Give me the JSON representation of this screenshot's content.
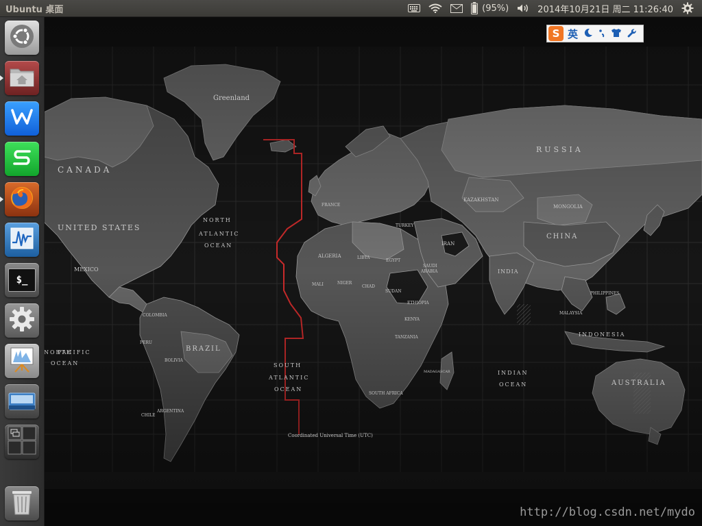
{
  "top_panel": {
    "app_title": "Ubuntu 桌面",
    "battery_percent": "(95%)",
    "datetime": "2014年10月21日 周二 11:26:40",
    "icons": [
      "keyboard-icon",
      "wifi-icon",
      "mail-icon",
      "battery-icon",
      "volume-icon",
      "gear-icon"
    ]
  },
  "launcher": {
    "items": [
      {
        "name": "dash-home",
        "icon": "ubuntu-logo-icon",
        "running": false
      },
      {
        "name": "files",
        "icon": "home-folder-icon",
        "running": true
      },
      {
        "name": "wps-writer",
        "icon": "wps-writer-icon",
        "label": "W",
        "running": false
      },
      {
        "name": "wps-spreadsheets",
        "icon": "wps-spreadsheets-icon",
        "label": "S",
        "running": false
      },
      {
        "name": "firefox",
        "icon": "firefox-icon",
        "running": true
      },
      {
        "name": "system-monitor",
        "icon": "system-monitor-icon",
        "running": false
      },
      {
        "name": "terminal",
        "icon": "terminal-icon",
        "label": "$_",
        "running": false
      },
      {
        "name": "system-settings",
        "icon": "settings-gear-icon",
        "running": false
      },
      {
        "name": "presentation",
        "icon": "presentation-icon",
        "running": false
      },
      {
        "name": "scanner",
        "icon": "scanner-icon",
        "running": false
      },
      {
        "name": "workspace-switcher",
        "icon": "workspace-switcher-icon",
        "running": false
      },
      {
        "name": "trash",
        "icon": "trash-icon",
        "running": false
      }
    ]
  },
  "ime": {
    "logo": "S",
    "mode": "英",
    "icons": [
      "moon-icon",
      "punctuation-icon",
      "shirt-icon",
      "wrench-icon"
    ]
  },
  "map": {
    "labels": {
      "greenland": "Greenland",
      "canada": "CANADA",
      "united_states": "UNITED STATES",
      "mexico": "MEXICO",
      "north_atlantic_1": "NORTH",
      "north_atlantic_2": "ATLANTIC",
      "north_atlantic_3": "OCEAN",
      "south_atlantic_1": "SOUTH",
      "south_atlantic_2": "ATLANTIC",
      "south_atlantic_3": "OCEAN",
      "north_pacific_1": "NORTH",
      "north_pacific_2": "PACIFIC",
      "north_pacific_3": "OCEAN",
      "indian_1": "INDIAN",
      "indian_2": "OCEAN",
      "brazil": "BRAZIL",
      "colombia": "COLOMBIA",
      "peru": "PERU",
      "bolivia": "BOLIVIA",
      "argentina": "ARGENTINA",
      "chile": "CHILE",
      "russia": "RUSSIA",
      "china": "CHINA",
      "mongolia": "MONGOLIA",
      "kazakhstan": "KAZAKHSTAN",
      "india": "INDIA",
      "iran": "IRAN",
      "saudi_1": "SAUDI",
      "saudi_2": "ARABIA",
      "algeria": "ALGERIA",
      "libya": "LIBYA",
      "egypt": "EGYPT",
      "sudan": "SUDAN",
      "niger": "NIGER",
      "mali": "MALI",
      "chad": "CHAD",
      "ethiopia": "ETHIOPIA",
      "kenya": "KENYA",
      "tanzania": "TANZANIA",
      "south_africa": "SOUTH AFRICA",
      "madagascar": "MADAGASCAR",
      "turkey": "TURKEY",
      "france": "FRANCE",
      "indonesia": "INDONESIA",
      "philippines": "PHILIPPINES",
      "malaysia": "MALAYSIA",
      "australia": "AUSTRALIA",
      "utc": "Coordinated Universal Time (UTC)"
    }
  },
  "watermark": "http://blog.csdn.net/mydo",
  "colors": {
    "panel": "#3c3b37",
    "launcher": "#333333",
    "red_line": "#cc2b2b",
    "land": "#5a5a5a",
    "ocean": "#111111"
  }
}
